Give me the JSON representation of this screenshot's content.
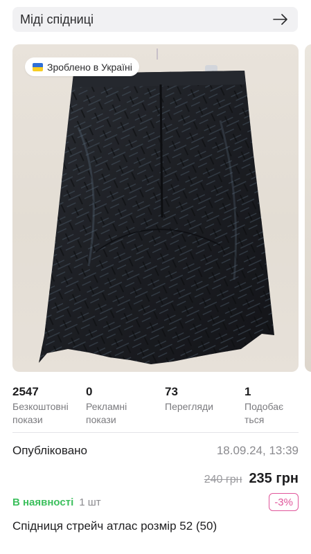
{
  "category": {
    "label": "Міді спідниці",
    "icon": "arrow-right-icon"
  },
  "badge": {
    "text": "Зроблено в Україні",
    "icon": "ukraine-flag-icon",
    "flag_colors": [
      "#2f6fd6",
      "#f7cd22"
    ]
  },
  "stats": [
    {
      "value": "2547",
      "label_line1": "Безкоштовні",
      "label_line2": "покази"
    },
    {
      "value": "0",
      "label_line1": "Рекламні",
      "label_line2": "покази"
    },
    {
      "value": "73",
      "label_line1": "Перегляди",
      "label_line2": ""
    },
    {
      "value": "1",
      "label_line1": "Подобає",
      "label_line2": "ться"
    }
  ],
  "published": {
    "label": "Опубліковано",
    "value": "18.09.24, 13:39"
  },
  "pricing": {
    "old_price": "240 грн",
    "price": "235 грн",
    "discount": "-3%"
  },
  "stock": {
    "status": "В наявності",
    "quantity": "1 шт"
  },
  "product": {
    "title": "Спідниця стрейч атлас розмір 52 (50)"
  },
  "colors": {
    "in_stock": "#3bbf5c",
    "discount": "#e0559a"
  }
}
